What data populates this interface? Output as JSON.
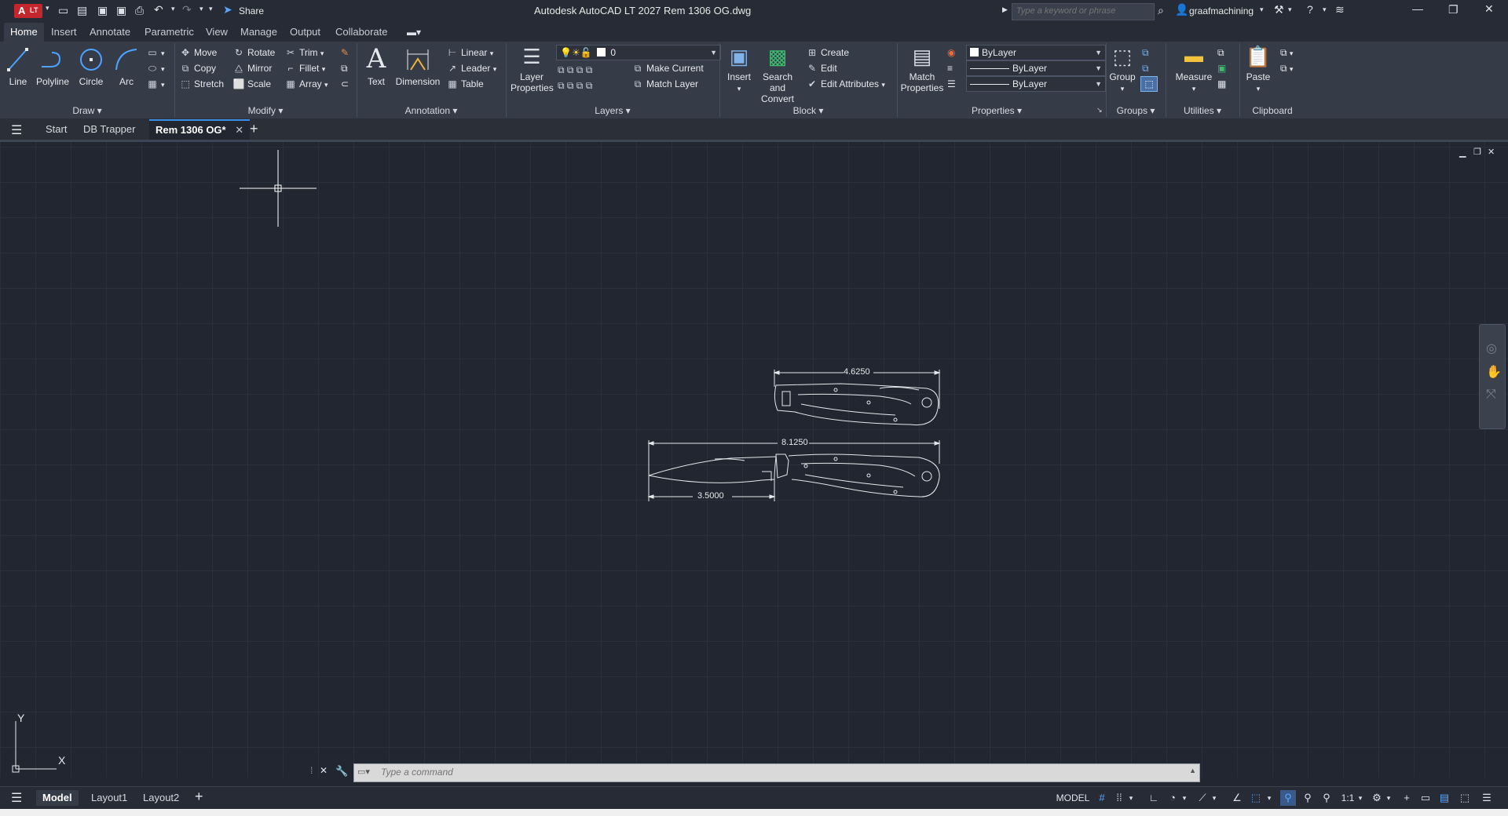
{
  "app": {
    "logo": "A",
    "logo_sub": "LT",
    "title": "Autodesk AutoCAD LT 2027   Rem 1306 OG.dwg",
    "share": "Share",
    "search_placeholder": "Type a keyword or phrase",
    "user": "graafmachining"
  },
  "ribbon_tabs": [
    "Home",
    "Insert",
    "Annotate",
    "Parametric",
    "View",
    "Manage",
    "Output",
    "Collaborate"
  ],
  "panels": {
    "draw": {
      "label": "Draw",
      "line": "Line",
      "polyline": "Polyline",
      "circle": "Circle",
      "arc": "Arc"
    },
    "modify": {
      "label": "Modify",
      "move": "Move",
      "rotate": "Rotate",
      "trim": "Trim",
      "copy": "Copy",
      "mirror": "Mirror",
      "fillet": "Fillet",
      "stretch": "Stretch",
      "scale": "Scale",
      "array": "Array"
    },
    "annotation": {
      "label": "Annotation",
      "text": "Text",
      "dimension": "Dimension",
      "linear": "Linear",
      "leader": "Leader",
      "table": "Table"
    },
    "layers": {
      "label": "Layers",
      "layer_properties_1": "Layer",
      "layer_properties_2": "Properties",
      "current_layer": "0",
      "make_current": "Make Current",
      "match_layer": "Match Layer"
    },
    "block": {
      "label": "Block",
      "insert": "Insert",
      "search_convert_1": "Search and",
      "search_convert_2": "Convert",
      "create": "Create",
      "edit": "Edit",
      "edit_attributes": "Edit Attributes"
    },
    "properties": {
      "label": "Properties",
      "match_1": "Match",
      "match_2": "Properties",
      "color": "ByLayer",
      "linetype": "ByLayer",
      "lineweight": "ByLayer"
    },
    "groups": {
      "label": "Groups",
      "group": "Group"
    },
    "utilities": {
      "label": "Utilities",
      "measure": "Measure"
    },
    "clipboard": {
      "label": "Clipboard",
      "paste": "Paste"
    }
  },
  "file_tabs": [
    "Start",
    "DB Trapper",
    "Rem 1306 OG*"
  ],
  "drawing": {
    "dim_top": "4.6250",
    "dim_overall": "8.1250",
    "dim_blade": "3.5000",
    "ucs_y": "Y",
    "ucs_x": "X"
  },
  "command": {
    "placeholder": "Type a command"
  },
  "layout_tabs": [
    "Model",
    "Layout1",
    "Layout2"
  ],
  "status": {
    "model": "MODEL",
    "scale": "1:1"
  },
  "colors": {
    "accent": "#3a8ee6",
    "background": "#212630",
    "ribbon": "#353b47"
  }
}
